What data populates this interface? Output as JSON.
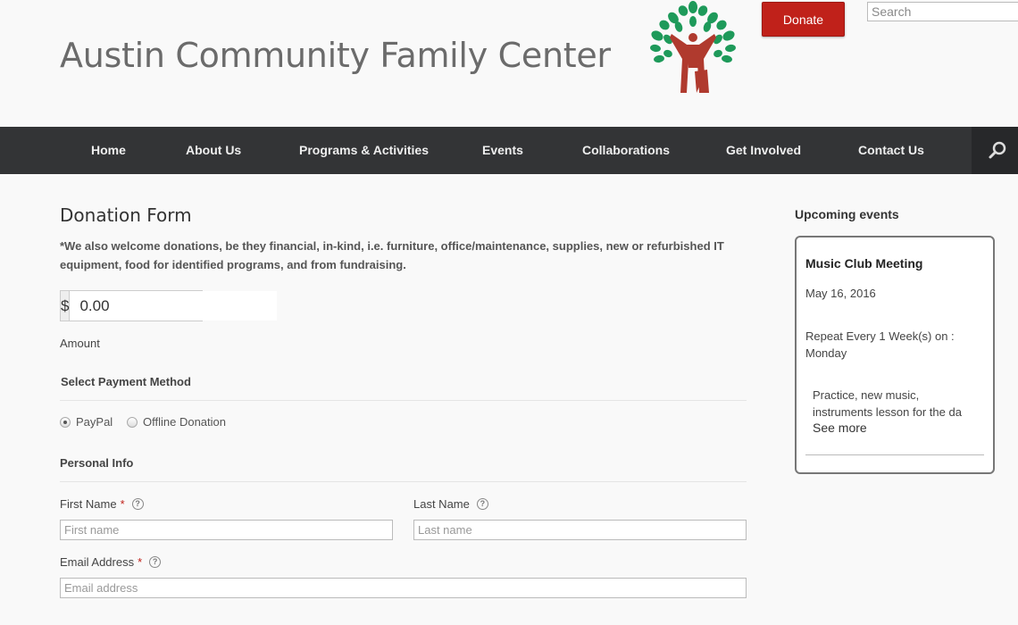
{
  "header": {
    "site_title": "Austin Community Family Center",
    "donate_label": "Donate",
    "search_placeholder": "Search"
  },
  "nav": {
    "items": [
      "Home",
      "About Us",
      "Programs & Activities",
      "Events",
      "Collaborations",
      "Get Involved",
      "Contact Us"
    ],
    "search_icon": "search-icon"
  },
  "form": {
    "title": "Donation Form",
    "note": "*We also welcome donations, be they financial, in-kind, i.e. furniture, office/maintenance, supplies, new or refurbished IT equipment, food for identified programs, and from fundraising.",
    "currency": "$",
    "amount_value": "0.00",
    "amount_label": "Amount",
    "payment_heading": "Select Payment Method",
    "payment_options": [
      {
        "label": "PayPal",
        "checked": true
      },
      {
        "label": "Offline Donation",
        "checked": false
      }
    ],
    "personal_heading": "Personal Info",
    "first_name_label": "First Name",
    "first_name_placeholder": "First name",
    "last_name_label": "Last Name",
    "last_name_placeholder": "Last name",
    "email_label": "Email Address",
    "email_placeholder": "Email address",
    "required_mark": "*",
    "help_glyph": "?"
  },
  "sidebar": {
    "title": "Upcoming events",
    "event": {
      "name": "Music Club Meeting",
      "date": "May 16, 2016",
      "repeat": "Repeat Every 1 Week(s) on : Monday",
      "description_line1": "Practice, new music,",
      "description_line2": "instruments lesson for the da",
      "see_more": "See more"
    }
  },
  "colors": {
    "accent": "#c0211a",
    "nav_bg": "#333436",
    "logo_leaf": "#1e9a5a",
    "logo_figure": "#b03a2e"
  }
}
